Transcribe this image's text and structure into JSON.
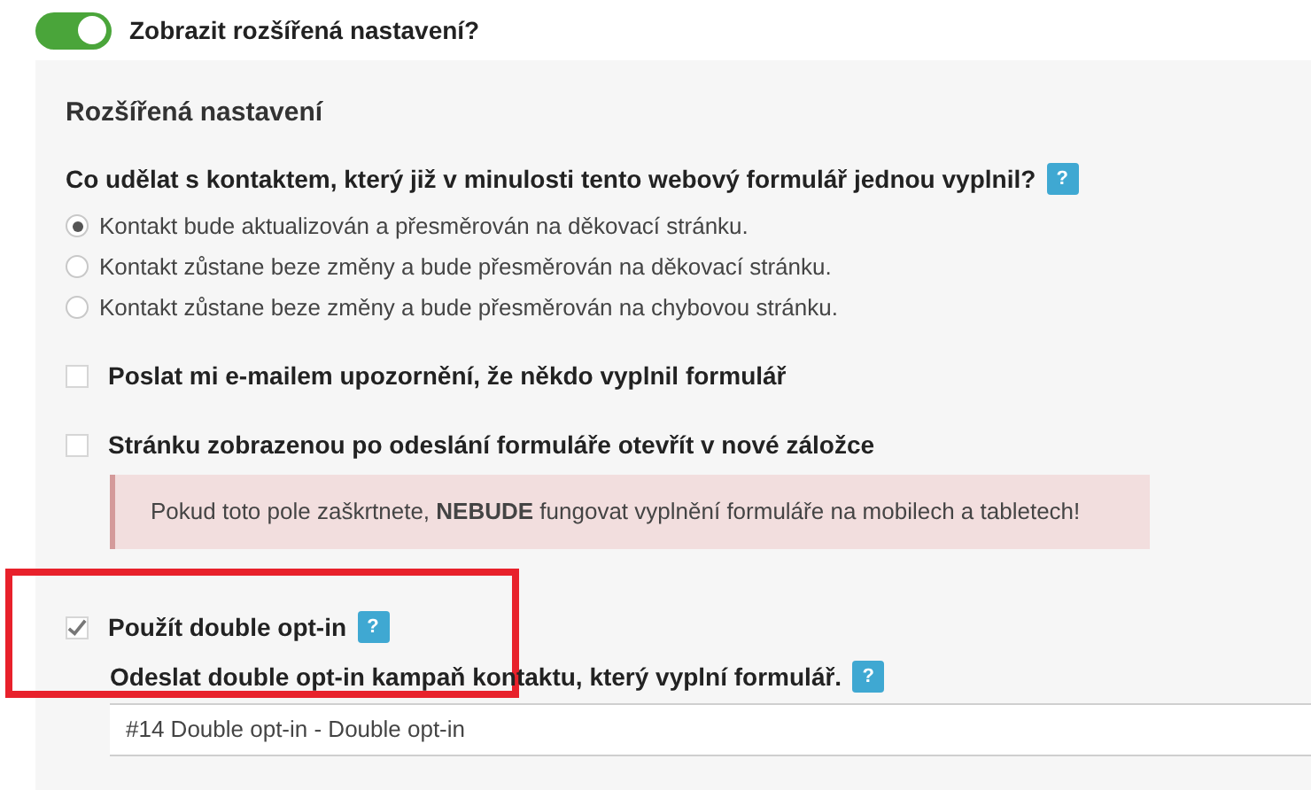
{
  "toggle": {
    "label": "Zobrazit rozšířená nastavení?",
    "on": true
  },
  "panel": {
    "title": "Rozšířená nastavení",
    "question": {
      "text": "Co udělat s kontaktem, který již v minulosti tento webový formulář jednou vyplnil?",
      "help": "?"
    },
    "options": [
      {
        "label": "Kontakt bude aktualizován a přesměrován na děkovací stránku.",
        "selected": true
      },
      {
        "label": "Kontakt zůstane beze změny a bude přesměrován na děkovací stránku.",
        "selected": false
      },
      {
        "label": "Kontakt zůstane beze změny a bude přesměrován na chybovou stránku.",
        "selected": false
      }
    ],
    "checkboxes": [
      {
        "label": "Poslat mi e-mailem upozornění, že někdo vyplnil formulář",
        "checked": false
      },
      {
        "label": "Stránku zobrazenou po odeslání formuláře otevřít v nové záložce",
        "checked": false,
        "warning": "Pokud toto pole zaškrtnete, **NEBUDE** fungovat vyplnění formuláře na mobilech a tabletech!"
      },
      {
        "label": "Použít double opt-in",
        "checked": true,
        "help": "?",
        "highlighted": true
      }
    ],
    "campaign": {
      "label": "Odeslat double opt-in kampaň kontaktu, který vyplní formulář.",
      "help": "?",
      "value": "#14 Double opt-in - Double opt-in"
    }
  }
}
